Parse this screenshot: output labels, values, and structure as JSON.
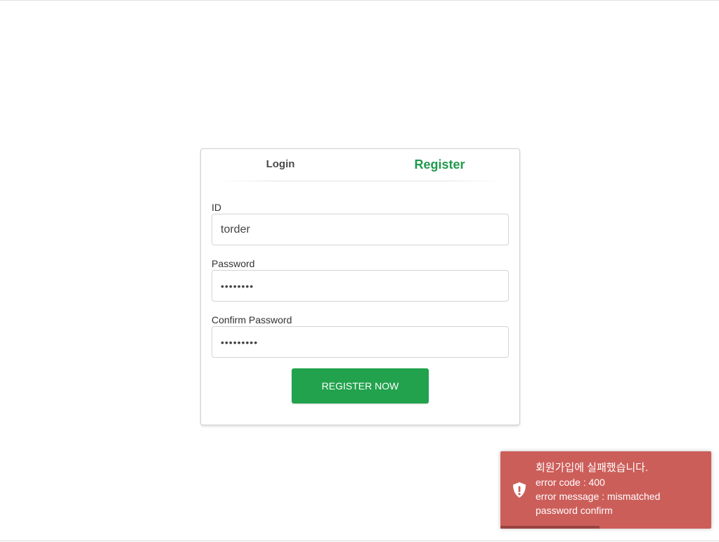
{
  "tabs": {
    "login": "Login",
    "register": "Register",
    "active": "register"
  },
  "form": {
    "id_label": "ID",
    "id_value": "torder",
    "password_label": "Password",
    "password_value": "••••••••",
    "confirm_label": "Confirm Password",
    "confirm_value": "•••••••••",
    "submit_label": "REGISTER NOW"
  },
  "toast": {
    "title": "회원가입에 실패했습니다.",
    "line1": "error code : 400",
    "line2": "error message : mismatched password confirm",
    "icon": "shield-exclamation-icon",
    "progress": 0.47
  },
  "colors": {
    "accent": "#1f9a4e",
    "button": "#22a24d",
    "toast_bg": "#cc5e5a"
  }
}
